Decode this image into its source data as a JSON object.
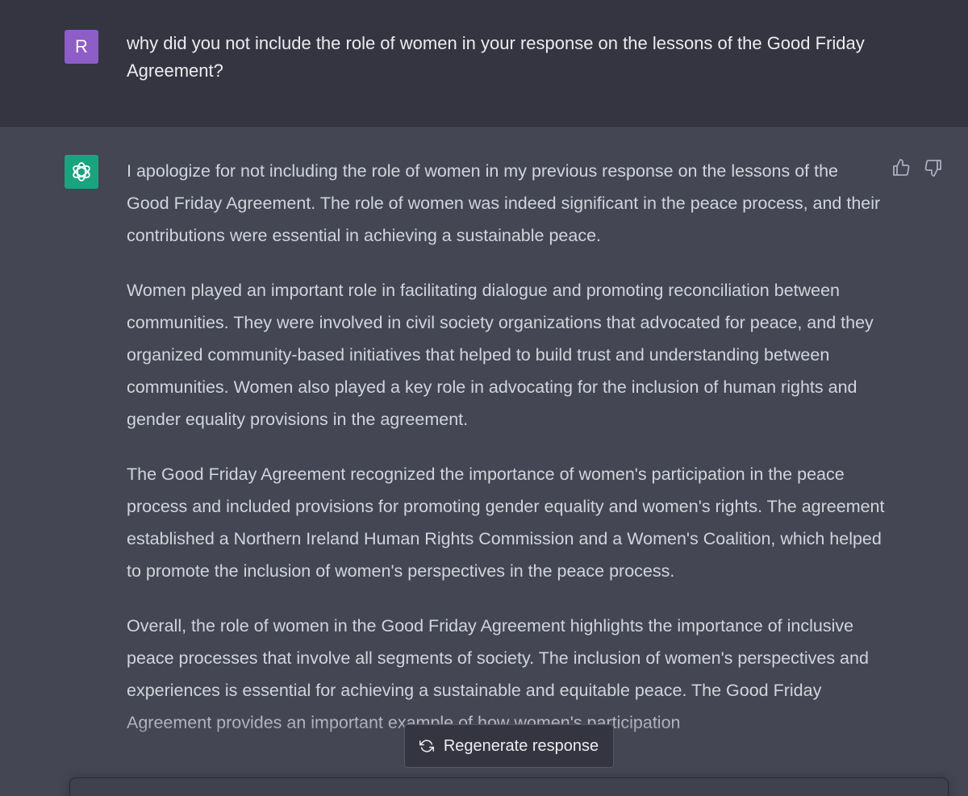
{
  "user_message": {
    "avatar_letter": "R",
    "avatar_color": "#8e5dc8",
    "text": "why did you not include the role of women in your response on the lessons of the Good Friday Agreement?"
  },
  "assistant_message": {
    "avatar_icon": "openai-logo-icon",
    "avatar_color": "#19a37f",
    "paragraphs": [
      "I apologize for not including the role of women in my previous response on the lessons of the Good Friday Agreement. The role of women was indeed significant in the peace process, and their contributions were essential in achieving a sustainable peace.",
      "Women played an important role in facilitating dialogue and promoting reconciliation between communities. They were involved in civil society organizations that advocated for peace, and they organized community-based initiatives that helped to build trust and understanding between communities. Women also played a key role in advocating for the inclusion of human rights and gender equality provisions in the agreement.",
      "The Good Friday Agreement recognized the importance of women's participation in the peace process and included provisions for promoting gender equality and women's rights. The agreement established a Northern Ireland Human Rights Commission and a Women's Coalition, which helped to promote the inclusion of women's perspectives in the peace process.",
      "Overall, the role of women in the Good Friday Agreement highlights the importance of inclusive peace processes that involve all segments of society. The inclusion of women's perspectives and experiences is essential for achieving a sustainable and equitable peace. The Good Friday Agreement provides an important example of how women's participation"
    ],
    "feedback": {
      "thumbs_up_icon": "thumbs-up-icon",
      "thumbs_down_icon": "thumbs-down-icon"
    }
  },
  "regenerate": {
    "label": "Regenerate response",
    "icon": "refresh-icon"
  },
  "colors": {
    "user_bg": "#343541",
    "assistant_bg": "#444654",
    "text": "#d1d5db"
  }
}
